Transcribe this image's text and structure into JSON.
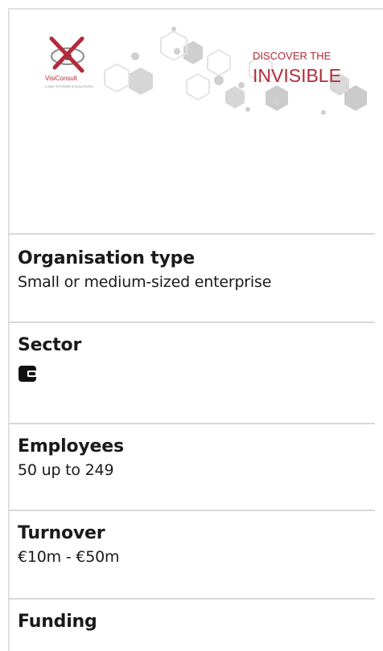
{
  "logo": {
    "brand_text": "VisiConsult",
    "brand_sub": "X-RAY SYSTEMS & SOLUTIONS",
    "tagline_line1": "DISCOVER THE",
    "tagline_line2": "INVISIBLE",
    "brand_color": "#b22b3a",
    "hex_color": "#c8c8c8"
  },
  "fields": [
    {
      "title": "Organisation type",
      "value": "Small or medium-sized enterprise"
    },
    {
      "title": "Sector",
      "icon": "wallet-icon"
    },
    {
      "title": "Employees",
      "value": "50 up to 249"
    },
    {
      "title": "Turnover",
      "value": "€10m - €50m"
    },
    {
      "title": "Funding"
    }
  ]
}
